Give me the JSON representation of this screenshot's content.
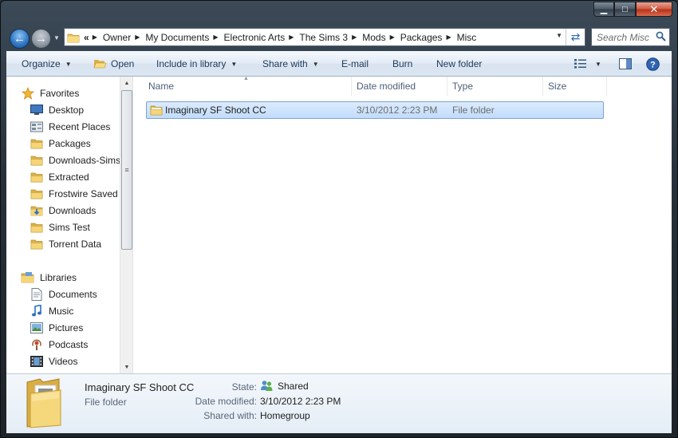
{
  "window": {
    "minimize_glyph": "▁",
    "maximize_glyph": "□",
    "close_glyph": "✕"
  },
  "nav": {
    "back_glyph": "←",
    "forward_glyph": "→",
    "overflow": "«",
    "breadcrumbs": [
      "Owner",
      "My Documents",
      "Electronic Arts",
      "The Sims 3",
      "Mods",
      "Packages",
      "Misc"
    ],
    "search_placeholder": "Search Misc"
  },
  "toolbar": {
    "organize": "Organize",
    "open": "Open",
    "include_in_library": "Include in library",
    "share_with": "Share with",
    "email": "E-mail",
    "burn": "Burn",
    "new_folder": "New folder"
  },
  "sidebar": {
    "favorites_header": "Favorites",
    "favorites": [
      {
        "label": "Desktop",
        "icon": "desktop-icon"
      },
      {
        "label": "Recent Places",
        "icon": "recent-places-icon"
      },
      {
        "label": "Packages",
        "icon": "folder-icon"
      },
      {
        "label": "Downloads-Sims",
        "icon": "folder-icon"
      },
      {
        "label": "Extracted",
        "icon": "folder-icon"
      },
      {
        "label": "Frostwire Saved",
        "icon": "folder-icon"
      },
      {
        "label": "Downloads",
        "icon": "downloads-folder-icon"
      },
      {
        "label": "Sims Test",
        "icon": "folder-icon"
      },
      {
        "label": "Torrent Data",
        "icon": "folder-icon"
      }
    ],
    "libraries_header": "Libraries",
    "libraries": [
      {
        "label": "Documents",
        "icon": "documents-icon"
      },
      {
        "label": "Music",
        "icon": "music-icon"
      },
      {
        "label": "Pictures",
        "icon": "pictures-icon"
      },
      {
        "label": "Podcasts",
        "icon": "podcasts-icon"
      },
      {
        "label": "Videos",
        "icon": "videos-icon"
      }
    ]
  },
  "filelist": {
    "columns": {
      "name": "Name",
      "date_modified": "Date modified",
      "type": "Type",
      "size": "Size"
    },
    "rows": [
      {
        "name": "Imaginary SF Shoot CC",
        "date_modified": "3/10/2012 2:23 PM",
        "type": "File folder",
        "size": "",
        "selected": true
      }
    ]
  },
  "details": {
    "name": "Imaginary SF Shoot CC",
    "kind": "File folder",
    "state_label": "State:",
    "state_value": "Shared",
    "date_label": "Date modified:",
    "date_value": "3/10/2012 2:23 PM",
    "shared_label": "Shared with:",
    "shared_value": "Homegroup"
  },
  "colors": {
    "selection_fill": "#c8e0fc",
    "selection_border": "#7da2ce",
    "folder_yellow": "#f3d374",
    "toolbar_text": "#1e395b"
  }
}
